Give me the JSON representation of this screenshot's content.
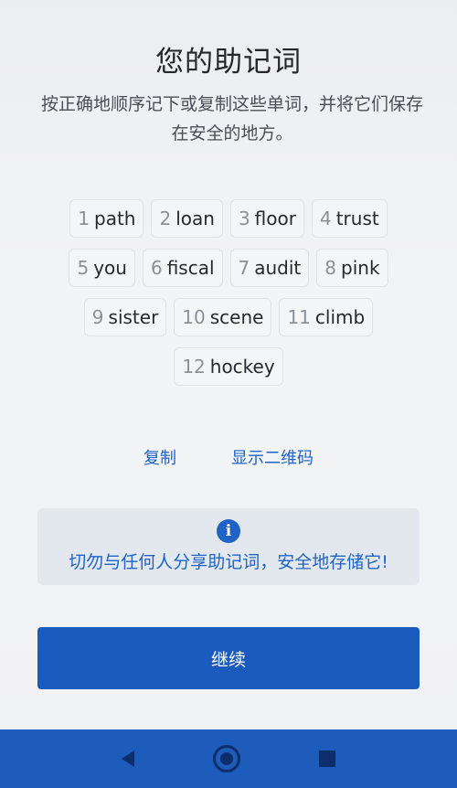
{
  "header": {
    "title": "您的助记词",
    "subtitle": "按正确地顺序记下或复制这些单词，并将它们保存在安全的地方。"
  },
  "mnemonic": {
    "rows": [
      [
        {
          "num": "1",
          "word": "path"
        },
        {
          "num": "2",
          "word": "loan"
        },
        {
          "num": "3",
          "word": "floor"
        },
        {
          "num": "4",
          "word": "trust"
        }
      ],
      [
        {
          "num": "5",
          "word": "you"
        },
        {
          "num": "6",
          "word": "fiscal"
        },
        {
          "num": "7",
          "word": "audit"
        },
        {
          "num": "8",
          "word": "pink"
        }
      ],
      [
        {
          "num": "9",
          "word": "sister"
        },
        {
          "num": "10",
          "word": "scene"
        },
        {
          "num": "11",
          "word": "climb"
        }
      ],
      [
        {
          "num": "12",
          "word": "hockey"
        }
      ]
    ]
  },
  "actions": {
    "copy_label": "复制",
    "show_qr_label": "显示二维码"
  },
  "notice": {
    "icon": "info-icon",
    "text": "切勿与任何人分享助记词，安全地存储它!"
  },
  "continue_label": "继续",
  "navbar": {
    "icons": [
      "back-icon",
      "home-icon",
      "recents-icon"
    ]
  },
  "colors": {
    "accent": "#1f63c6",
    "button": "#1b5bbd",
    "navbar": "#1d5cba"
  }
}
